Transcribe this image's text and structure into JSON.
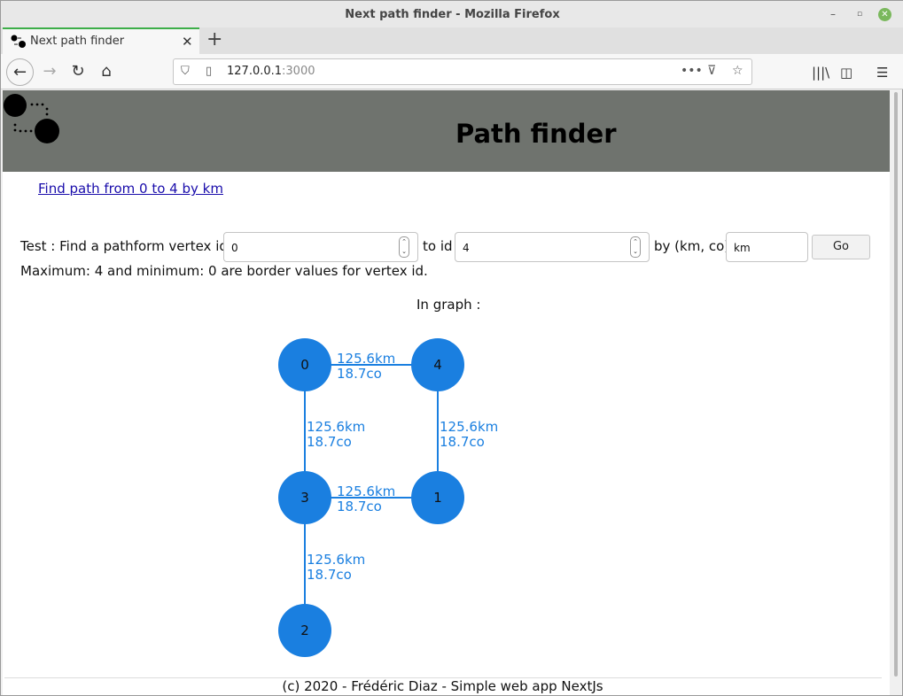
{
  "window": {
    "title": "Next path finder - Mozilla Firefox",
    "controls": [
      "–",
      "▫",
      "✕"
    ]
  },
  "tabs": [
    {
      "label": "Next path finder",
      "close": "✕"
    }
  ],
  "newtab": "+",
  "nav": {
    "url_host": "127.0.0.1",
    "url_port": ":3000",
    "more": "•••"
  },
  "page": {
    "title": "Path finder",
    "link": "Find path from 0 to 4 by km",
    "form": {
      "label_from": "Test : Find a pathform vertex id",
      "from_value": "0",
      "label_to": "to id",
      "to_value": "4",
      "label_by": "by (km, co)",
      "by_value": "km",
      "go": "Go"
    },
    "note": "Maximum: 4 and minimum: 0 are border values for vertex id.",
    "graph_label": "In graph :",
    "footer": "(c) 2020 - Frédéric Diaz - Simple web app NextJs"
  },
  "graph": {
    "node_color": "#1a7fe0",
    "edge_color": "#1a7fe0",
    "label_color": "#1a7fe0",
    "nodes": [
      {
        "id": "0"
      },
      {
        "id": "4"
      },
      {
        "id": "3"
      },
      {
        "id": "1"
      },
      {
        "id": "2"
      }
    ],
    "edges": [
      {
        "from": "0",
        "to": "4",
        "km": "125.6km",
        "co": "18.7co"
      },
      {
        "from": "0",
        "to": "3",
        "km": "125.6km",
        "co": "18.7co"
      },
      {
        "from": "4",
        "to": "1",
        "km": "125.6km",
        "co": "18.7co"
      },
      {
        "from": "3",
        "to": "1",
        "km": "125.6km",
        "co": "18.7co"
      },
      {
        "from": "3",
        "to": "2",
        "km": "125.6km",
        "co": "18.7co"
      }
    ]
  }
}
